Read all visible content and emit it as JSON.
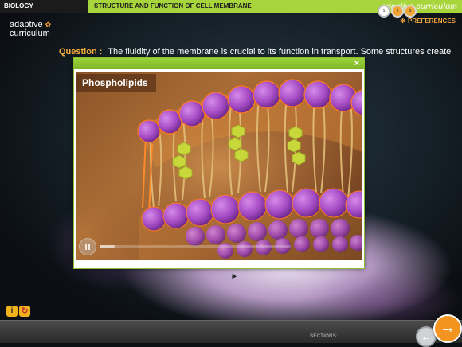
{
  "header": {
    "subject": "BIOLOGY",
    "title": "STRUCTURE AND FUNCTION OF CELL MEMBRANE",
    "brand": "adaptive curriculum"
  },
  "logo": {
    "line1": "adaptive",
    "line2": "curriculum"
  },
  "preferences": {
    "label": "PREFERENCES",
    "icon": "gear-icon"
  },
  "question": {
    "label": "Question :",
    "text": "The fluidity of the membrane is crucial to its function in transport. Some structures create"
  },
  "modal": {
    "close_icon": "close-icon",
    "video_title": "Phospholipids",
    "progress": 0.08,
    "pause_icon": "pause-icon"
  },
  "tools": {
    "info_icon": "info-icon",
    "reload_icon": "reload-icon"
  },
  "footer": {
    "sections_label": "SECTIONS:",
    "sections": [
      "1",
      "2",
      "3"
    ],
    "back_icon": "arrow-left-icon",
    "next_icon": "arrow-right-icon"
  },
  "colors": {
    "accent": "#a8d53c",
    "orange": "#f39421",
    "membrane": "#a54bc4"
  }
}
